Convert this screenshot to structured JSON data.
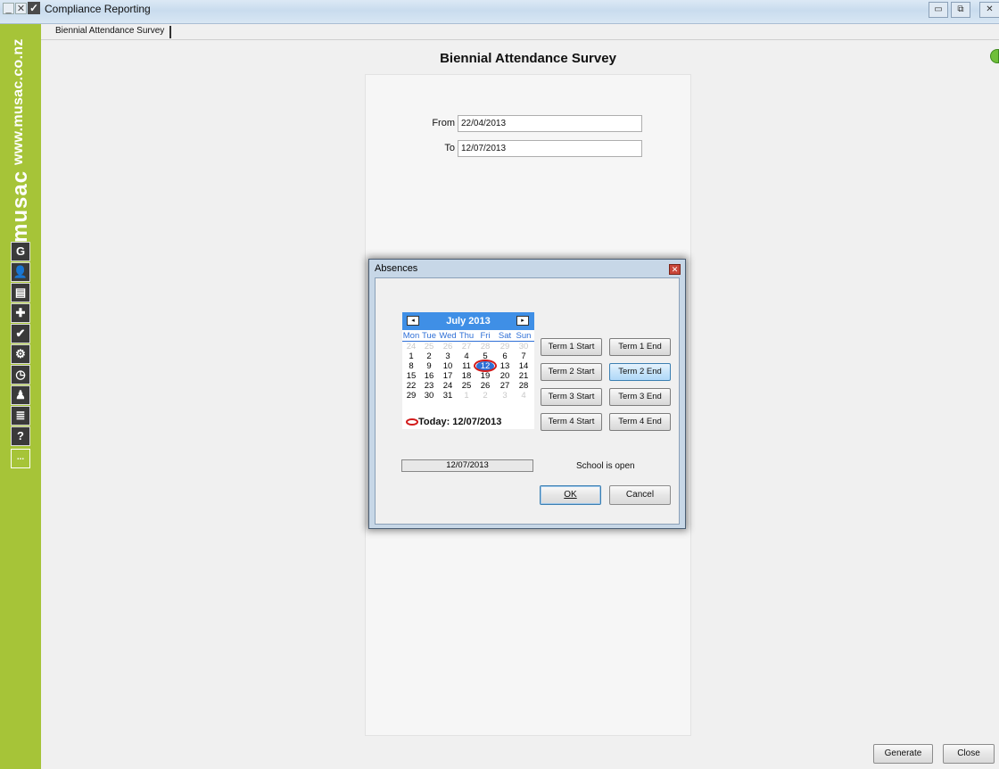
{
  "window": {
    "title": "Compliance Reporting",
    "minimize_glyph": "_",
    "close_glyph": "✕",
    "restore_glyph": "▭",
    "maximize_glyph": "⧉",
    "exit_glyph": "✕"
  },
  "tab": {
    "label": "Biennial Attendance Survey"
  },
  "sidebar": {
    "url": "www.musac.co.nz",
    "brand": "musac",
    "icons": [
      {
        "name": "login-icon",
        "glyph": "G"
      },
      {
        "name": "people-icon",
        "glyph": "👤"
      },
      {
        "name": "building-icon",
        "glyph": "▤"
      },
      {
        "name": "puzzle-icon",
        "glyph": "✚"
      },
      {
        "name": "checkmark-icon",
        "glyph": "✔"
      },
      {
        "name": "gear-icon",
        "glyph": "⚙"
      },
      {
        "name": "clock-icon",
        "glyph": "◷"
      },
      {
        "name": "person-icon",
        "glyph": "♟"
      },
      {
        "name": "database-icon",
        "glyph": "≣"
      },
      {
        "name": "help-icon",
        "glyph": "?"
      },
      {
        "name": "more-icon",
        "glyph": "..."
      }
    ]
  },
  "main": {
    "heading": "Biennial Attendance Survey",
    "from_label": "From",
    "from_value": "22/04/2013",
    "to_label": "To",
    "to_value": "12/07/2013"
  },
  "footer": {
    "generate_label": "Generate",
    "close_label": "Close"
  },
  "dialog": {
    "title": "Absences",
    "close_glyph": "✕",
    "calendar": {
      "month_title": "July 2013",
      "prev_glyph": "◂",
      "next_glyph": "▸",
      "weekdays": [
        "Mon",
        "Tue",
        "Wed",
        "Thu",
        "Fri",
        "Sat",
        "Sun"
      ],
      "weeks": [
        [
          "24",
          "25",
          "26",
          "27",
          "28",
          "29",
          "30"
        ],
        [
          "1",
          "2",
          "3",
          "4",
          "5",
          "6",
          "7"
        ],
        [
          "8",
          "9",
          "10",
          "11",
          "12",
          "13",
          "14"
        ],
        [
          "15",
          "16",
          "17",
          "18",
          "19",
          "20",
          "21"
        ],
        [
          "22",
          "23",
          "24",
          "25",
          "26",
          "27",
          "28"
        ],
        [
          "29",
          "30",
          "31",
          "1",
          "2",
          "3",
          "4"
        ]
      ],
      "today_text": "Today: 12/07/2013"
    },
    "term_buttons": [
      {
        "start": "Term 1 Start",
        "end": "Term 1 End"
      },
      {
        "start": "Term 2 Start",
        "end": "Term 2 End"
      },
      {
        "start": "Term 3 Start",
        "end": "Term 3 End"
      },
      {
        "start": "Term 4 Start",
        "end": "Term 4 End"
      }
    ],
    "selected_date": "12/07/2013",
    "school_status": "School is open",
    "ok_label": "OK",
    "cancel_label": "Cancel"
  }
}
